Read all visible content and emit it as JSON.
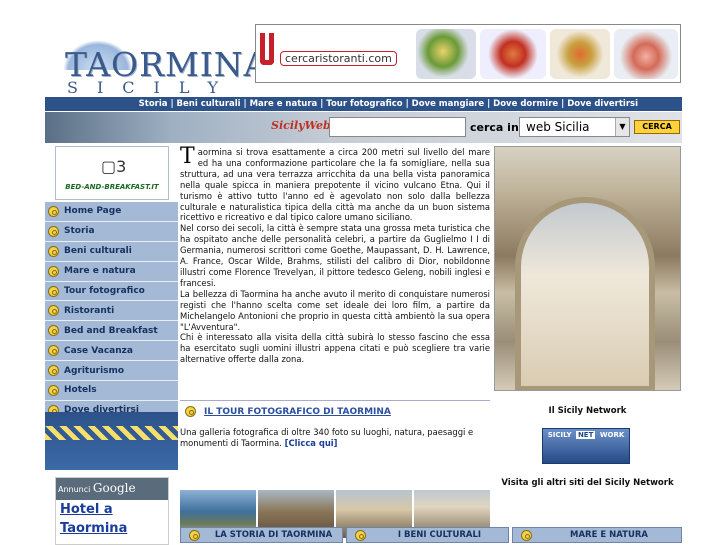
{
  "logo": {
    "title": "TAORMINA",
    "subtitle": "SICILY"
  },
  "banner": {
    "text": "cercaristoranti.com"
  },
  "nav": {
    "text": "Storia | Beni culturali | Mare e natura | Tour fotografico | Dove mangiare | Dove dormire | Dove divertirsi"
  },
  "search": {
    "brand": "SicilyWeb",
    "value": "",
    "label": "cerca in:",
    "scope": "web Sicilia",
    "button": "CERCA"
  },
  "sidebar": {
    "bb_label": "BED-AND-BREAKFAST.IT",
    "items": [
      {
        "label": "Home Page"
      },
      {
        "label": "Storia"
      },
      {
        "label": "Beni culturali"
      },
      {
        "label": "Mare e natura"
      },
      {
        "label": "Tour fotografico"
      },
      {
        "label": "Ristoranti"
      },
      {
        "label": "Bed and Breakfast"
      },
      {
        "label": "Case Vacanza"
      },
      {
        "label": "Agriturismo"
      },
      {
        "label": "Hotels"
      },
      {
        "label": "Dove divertirsi"
      }
    ],
    "ads": {
      "header": "Annunci",
      "brand": "Google",
      "link": "Hotel a Taormina"
    }
  },
  "main": {
    "dropcap": "T",
    "p1": "aormina si trova esattamente a circa 200 metri sul livello del mare ed ha una conformazione particolare che la fa somigliare, nella sua struttura, ad una vera terrazza arricchita da una bella vista panoramica nella quale spicca in maniera prepotente il vicino vulcano Etna. Qui il turismo è attivo tutto l'anno ed è agevolato non solo dalla bellezza culturale e naturalistica tipica della città ma anche da un buon sistema ricettivo e ricreativo e dal tipico calore umano siciliano.",
    "p2": "Nel corso dei secoli, la città è sempre stata una grossa meta turistica che ha ospitato anche delle personalità celebri, a partire da Guglielmo I I di Germania, numerosi scrittori come Goethe, Maupassant, D. H. Lawrence, A. France, Oscar Wilde, Brahms, stilisti del calibro di Dior, nobildonne illustri come Florence Trevelyan, il pittore tedesco Geleng, nobili inglesi e francesi.",
    "p3": "La bellezza di Taormina ha anche avuto il merito di conquistare numerosi registi che l'hanno scelta come set ideale dei loro film, a partire da Michelangelo Antonioni che proprio in questa città ambientò la sua opera \"L'Avventura\".",
    "p4": "Chi è interessato alla visita della città subirà lo stesso fascino che essa ha esercitato sugli uomini illustri appena citati e può scegliere tra varie alternative offerte dalla zona.",
    "tour_title": "IL TOUR FOTOGRAFICO DI TAORMINA",
    "tour_desc": "Una galleria fotografica di oltre 340 foto su luoghi, natura, paesaggi e monumenti di Taormina.",
    "tour_link": "[Clicca qui]"
  },
  "network": {
    "title": "Il Sicily Network",
    "logo_a": "SICILY",
    "logo_b": "NET",
    "logo_c": "WORK",
    "visit": "Visita gli altri siti del Sicily Network"
  },
  "bottom": [
    {
      "label": "LA STORIA DI TAORMINA"
    },
    {
      "label": "I BENI CULTURALI"
    },
    {
      "label": "MARE E NATURA"
    }
  ]
}
